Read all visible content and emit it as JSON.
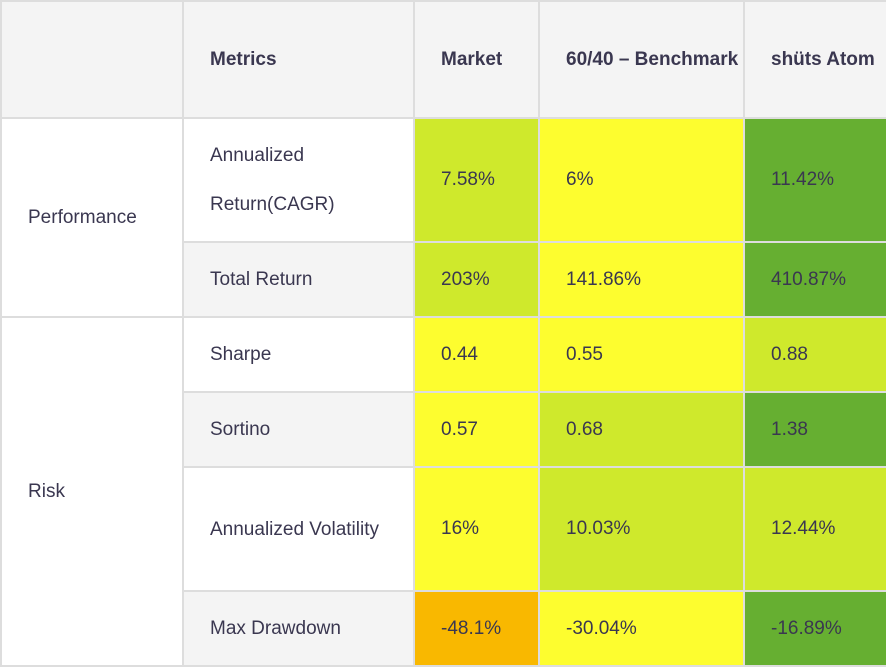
{
  "colors": {
    "header_bg": "#f4f4f4",
    "border": "#dddddd",
    "text": "#3a3750",
    "yellow": "#fdfd2f",
    "lime": "#cfe92c",
    "green": "#66af31",
    "orange": "#f9b800"
  },
  "table": {
    "headers": {
      "category": "",
      "metrics": "Metrics",
      "market": "Market",
      "benchmark": "60/40 – Benchmark",
      "shuts": "shüts Atom"
    },
    "groups": [
      {
        "category": "Performance",
        "rows": [
          {
            "metric": "Annualized Return(CAGR)",
            "market": {
              "value": "7.58%",
              "color": "#cfe92c"
            },
            "benchmark": {
              "value": "6%",
              "color": "#fdfd2f"
            },
            "shuts": {
              "value": "11.42%",
              "color": "#66af31"
            }
          },
          {
            "metric": "Total Return",
            "market": {
              "value": "203%",
              "color": "#cfe92c"
            },
            "benchmark": {
              "value": "141.86%",
              "color": "#fdfd2f"
            },
            "shuts": {
              "value": "410.87%",
              "color": "#66af31"
            }
          }
        ]
      },
      {
        "category": "Risk",
        "rows": [
          {
            "metric": "Sharpe",
            "market": {
              "value": "0.44",
              "color": "#fdfd2f"
            },
            "benchmark": {
              "value": "0.55",
              "color": "#fdfd2f"
            },
            "shuts": {
              "value": "0.88",
              "color": "#cfe92c"
            }
          },
          {
            "metric": "Sortino",
            "market": {
              "value": "0.57",
              "color": "#fdfd2f"
            },
            "benchmark": {
              "value": "0.68",
              "color": "#cfe92c"
            },
            "shuts": {
              "value": "1.38",
              "color": "#66af31"
            }
          },
          {
            "metric": "Annualized Volatility",
            "market": {
              "value": "16%",
              "color": "#fdfd2f"
            },
            "benchmark": {
              "value": "10.03%",
              "color": "#cfe92c"
            },
            "shuts": {
              "value": "12.44%",
              "color": "#cfe92c"
            }
          },
          {
            "metric": "Max Drawdown",
            "market": {
              "value": "-48.1%",
              "color": "#f9b800"
            },
            "benchmark": {
              "value": "-30.04%",
              "color": "#fdfd2f"
            },
            "shuts": {
              "value": "-16.89%",
              "color": "#66af31"
            }
          }
        ]
      }
    ]
  }
}
